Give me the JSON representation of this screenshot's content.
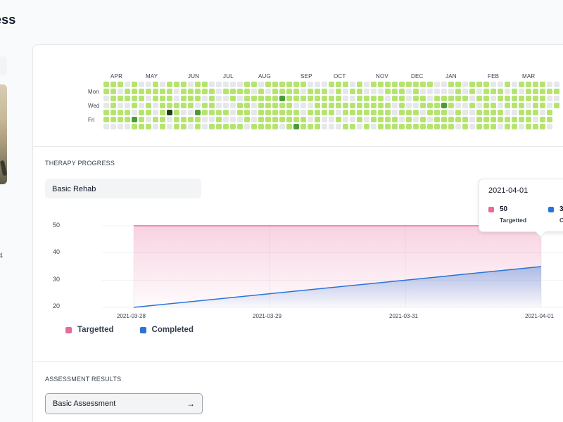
{
  "page": {
    "title": "ess",
    "left_char": "4"
  },
  "heatmap": {
    "months": [
      "APR",
      "MAY",
      "JUN",
      "JUL",
      "AUG",
      "SEP",
      "OCT",
      "NOV",
      "DEC",
      "JAN",
      "FEB",
      "MAR"
    ],
    "days": [
      "Mon",
      "Wed",
      "Fri"
    ],
    "colors": {
      "empty": "#e5e7eb",
      "low": "#b5e46e",
      "mid": "#7cc050",
      "high": "#4a9b38",
      "max": "#1f3d1a"
    }
  },
  "therapy": {
    "section_label": "THERAPY PROGRESS",
    "plan_select": "Basic Rehab"
  },
  "chart_data": {
    "type": "area",
    "x": [
      "2021-03-28",
      "2021-03-29",
      "2021-03-31",
      "2021-04-01"
    ],
    "yticks": [
      20,
      30,
      40,
      50
    ],
    "ylim": [
      20,
      50
    ],
    "series": [
      {
        "name": "Targetted",
        "color": "#e8699c",
        "values": [
          50,
          50,
          50,
          50
        ]
      },
      {
        "name": "Completed",
        "color": "#2b73d6",
        "values": [
          20,
          25,
          30,
          35
        ]
      }
    ],
    "legend": "bottom-left"
  },
  "tooltip": {
    "date": "2021-04-01",
    "entries": [
      {
        "value": "50",
        "label": "Targetted",
        "color": "#e8699c"
      },
      {
        "value": "3",
        "label": "C",
        "color": "#2b73d6"
      }
    ]
  },
  "assessment": {
    "section_label": "ASSESSMENT RESULTS",
    "button_label": "Basic Assessment",
    "arrow": "→"
  }
}
